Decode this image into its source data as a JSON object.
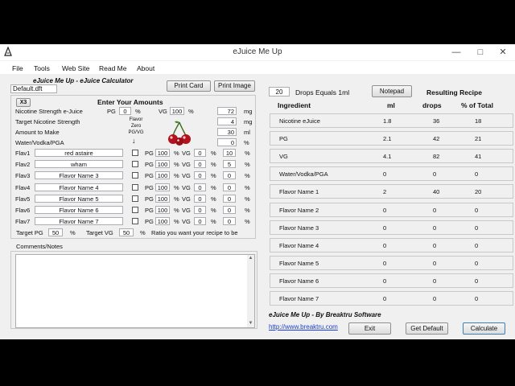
{
  "window": {
    "title": "eJuice Me Up",
    "minimize": "—",
    "maximize": "□",
    "close": "✕"
  },
  "menu": [
    "File",
    "Tools",
    "Web Site",
    "Read Me",
    "About"
  ],
  "left": {
    "recipe_file": "Default.dft",
    "app_heading": "eJuice Me Up - eJuice Calculator",
    "print_card": "Print Card",
    "print_image": "Print Image",
    "x3": "X3",
    "enter_amounts": "Enter Your Amounts",
    "nicotine_strength_label": "Nicotine Strength e-Juice",
    "pg_label": "PG",
    "nic_pg": "0",
    "pct": "%",
    "vg_label": "VG",
    "nic_vg": "100",
    "nic_strength": "72",
    "mg": "mg",
    "target_nic_label": "Target Nicotine Strength",
    "target_nic": "4",
    "amount_label": "Amount to Make",
    "amount": "30",
    "ml": "ml",
    "water_label": "Water/Vodka/PGA",
    "water": "0",
    "flavor_zero_note": "Flavor Zero PG/VG",
    "arrow": "↓",
    "flavors": [
      {
        "label": "Flav1",
        "name": "red astaire",
        "pg": "100",
        "vg": "0",
        "pct": "10"
      },
      {
        "label": "Flav2",
        "name": "wham",
        "pg": "100",
        "vg": "0",
        "pct": "5"
      },
      {
        "label": "Flav3",
        "name": "Flavor Name 3",
        "pg": "100",
        "vg": "0",
        "pct": "0"
      },
      {
        "label": "Flav4",
        "name": "Flavor Name 4",
        "pg": "100",
        "vg": "0",
        "pct": "0"
      },
      {
        "label": "Flav5",
        "name": "Flavor Name 5",
        "pg": "100",
        "vg": "0",
        "pct": "0"
      },
      {
        "label": "Flav6",
        "name": "Flavor Name 6",
        "pg": "100",
        "vg": "0",
        "pct": "0"
      },
      {
        "label": "Flav7",
        "name": "Flavor Name 7",
        "pg": "100",
        "vg": "0",
        "pct": "0"
      }
    ],
    "target_pg_label": "Target PG",
    "target_pg": "50",
    "target_vg_label": "Target VG",
    "target_vg": "50",
    "ratio_note": "Ratio you want your recipe to be",
    "comments_label": "Comments/Notes",
    "comments": ""
  },
  "right": {
    "drops": "20",
    "drops_label": "Drops Equals 1ml",
    "notepad": "Notepad",
    "resulting": "Resulting Recipe",
    "col_ingredient": "Ingredient",
    "col_ml": "ml",
    "col_drops": "drops",
    "col_pct": "% of Total",
    "rows": [
      {
        "name": "Nicotine eJuice",
        "ml": "1.8",
        "drops": "36",
        "pct": "18"
      },
      {
        "name": "PG",
        "ml": "2.1",
        "drops": "42",
        "pct": "21"
      },
      {
        "name": "VG",
        "ml": "4.1",
        "drops": "82",
        "pct": "41"
      },
      {
        "name": "Water/Vodka/PGA",
        "ml": "0",
        "drops": "0",
        "pct": "0"
      },
      {
        "name": "Flavor Name 1",
        "ml": "2",
        "drops": "40",
        "pct": "20"
      },
      {
        "name": "Flavor Name 2",
        "ml": "0",
        "drops": "0",
        "pct": "0"
      },
      {
        "name": "Flavor Name 3",
        "ml": "0",
        "drops": "0",
        "pct": "0"
      },
      {
        "name": "Flavor Name 4",
        "ml": "0",
        "drops": "0",
        "pct": "0"
      },
      {
        "name": "Flavor Name 5",
        "ml": "0",
        "drops": "0",
        "pct": "0"
      },
      {
        "name": "Flavor Name 6",
        "ml": "0",
        "drops": "0",
        "pct": "0"
      },
      {
        "name": "Flavor Name 7",
        "ml": "0",
        "drops": "0",
        "pct": "0"
      }
    ],
    "credit": "eJuice Me Up - By Breaktru Software",
    "link": "http://www.breaktru.com",
    "exit": "Exit",
    "get_default": "Get Default",
    "calculate": "Calculate"
  }
}
